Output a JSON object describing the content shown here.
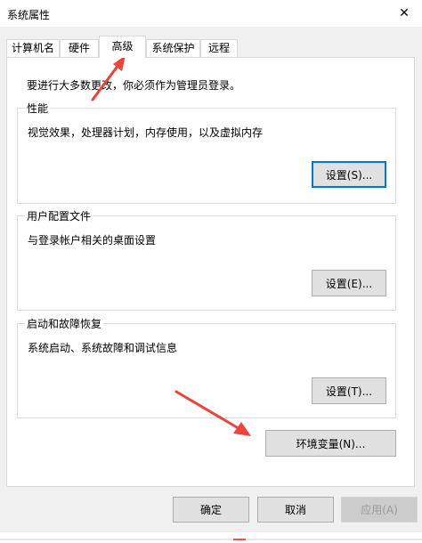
{
  "window": {
    "title": "系统属性",
    "close_glyph": "✕"
  },
  "tabs": [
    {
      "label": "计算机名"
    },
    {
      "label": "硬件"
    },
    {
      "label": "高级"
    },
    {
      "label": "系统保护"
    },
    {
      "label": "远程"
    }
  ],
  "panel": {
    "notice": "要进行大多数更改，你必须作为管理员登录。",
    "performance": {
      "label": "性能",
      "desc": "视觉效果，处理器计划，内存使用，以及虚拟内存",
      "button": "设置(S)..."
    },
    "user_profiles": {
      "label": "用户配置文件",
      "desc": "与登录帐户相关的桌面设置",
      "button": "设置(E)..."
    },
    "startup_recovery": {
      "label": "启动和故障恢复",
      "desc": "系统启动、系统故障和调试信息",
      "button": "设置(T)..."
    },
    "env_button": "环境变量(N)..."
  },
  "footer": {
    "ok": "确定",
    "cancel": "取消",
    "apply": "应用(A)"
  },
  "colors": {
    "arrow": "#f0413a",
    "accent": "#0078d7"
  }
}
